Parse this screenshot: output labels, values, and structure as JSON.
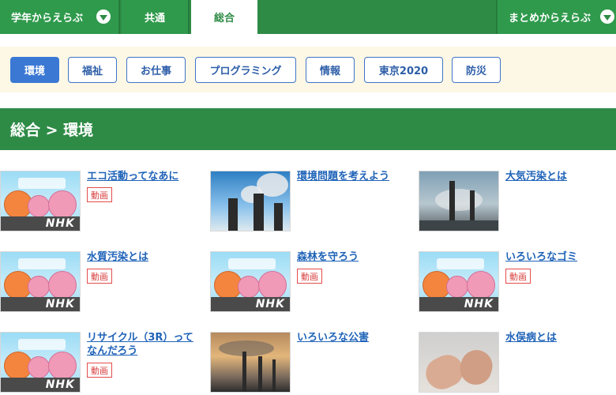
{
  "topnav": {
    "grade_label": "学年からえらぶ",
    "common_label": "共通",
    "general_label": "総合",
    "summary_label": "まとめからえらぶ"
  },
  "categories": [
    "環境",
    "福祉",
    "お仕事",
    "プログラミング",
    "情報",
    "東京2020",
    "防災"
  ],
  "active_category": "環境",
  "section_title": "総合 > 環境",
  "badge_label": "動画",
  "items": [
    {
      "title": "エコ活動ってなあに",
      "thumb": "nhk",
      "video": true
    },
    {
      "title": "環境問題を考えよう",
      "thumb": "smokestacks-blue-sky",
      "video": false
    },
    {
      "title": "大気汚染とは",
      "thumb": "factory-smoke",
      "video": false
    },
    {
      "title": "水質汚染とは",
      "thumb": "nhk",
      "video": true
    },
    {
      "title": "森林を守ろう",
      "thumb": "nhk",
      "video": true
    },
    {
      "title": "いろいろなゴミ",
      "thumb": "nhk",
      "video": true
    },
    {
      "title": "リサイクル（3R）ってなんだろう",
      "thumb": "nhk",
      "video": true
    },
    {
      "title": "いろいろな公害",
      "thumb": "sunset-smokestacks",
      "video": false
    },
    {
      "title": "水俣病とは",
      "thumb": "hands",
      "video": false
    }
  ],
  "nhk_logo": "NHK",
  "colors": {
    "green": "#2e8b46",
    "blue": "#3a78d4",
    "link": "#1f63b8",
    "badge_red": "#e44c4c",
    "cat_bg": "#fdf8e6"
  }
}
